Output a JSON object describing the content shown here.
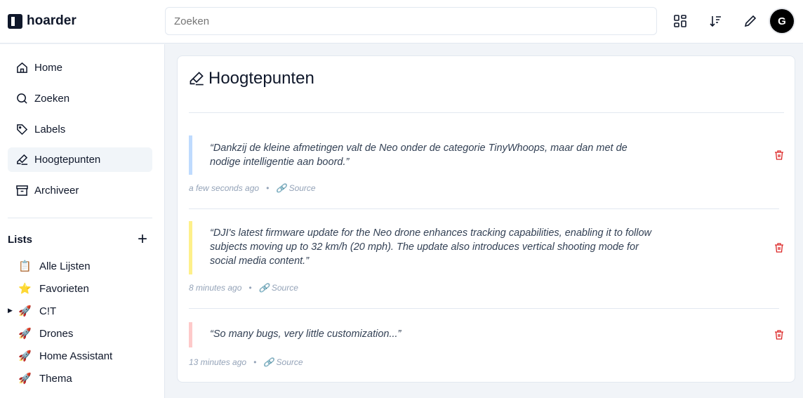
{
  "header": {
    "brand": "hoarder",
    "search_placeholder": "Zoeken",
    "avatar_initial": "G"
  },
  "sidebar": {
    "nav": [
      {
        "label": "Home"
      },
      {
        "label": "Zoeken"
      },
      {
        "label": "Labels"
      },
      {
        "label": "Hoogtepunten"
      },
      {
        "label": "Archiveer"
      }
    ],
    "lists_title": "Lists",
    "lists": [
      {
        "emoji": "📋",
        "label": "Alle Lijsten"
      },
      {
        "emoji": "⭐",
        "label": "Favorieten"
      },
      {
        "emoji": "🚀",
        "label": "C!T"
      },
      {
        "emoji": "🚀",
        "label": "Drones"
      },
      {
        "emoji": "🚀",
        "label": "Home Assistant"
      },
      {
        "emoji": "🚀",
        "label": "Thema"
      }
    ]
  },
  "main": {
    "title": "Hoogtepunten",
    "highlights": [
      {
        "text": "“Dankzij de kleine afmetingen valt de Neo onder de categorie TinyWhoops, maar dan met de nodige intelligentie aan boord.”",
        "time": "a few seconds ago",
        "source": "Source",
        "color": "#bfdbfe"
      },
      {
        "text": "“DJI's latest firmware update for the Neo drone enhances tracking capabilities, enabling it to follow subjects moving up to 32 km/h (20 mph). The update also introduces vertical shooting mode for social media content.”",
        "time": "8 minutes ago",
        "source": "Source",
        "color": "#fef08a"
      },
      {
        "text": "“So many bugs, very little customization...”",
        "time": "13 minutes ago",
        "source": "Source",
        "color": "#fecaca"
      }
    ]
  }
}
